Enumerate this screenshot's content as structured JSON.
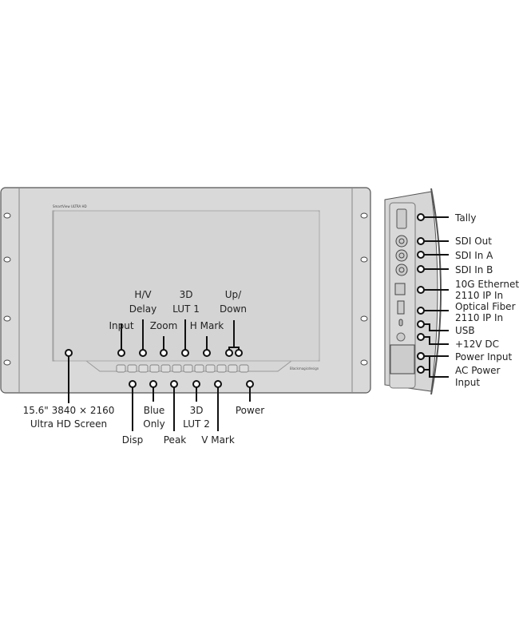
{
  "front_panel": {
    "brand_text": "SmartView ULTRA HD",
    "logo_text": "Blackmagicdesign",
    "labels_top": {
      "input": "Input",
      "hv_delay": [
        "H/V",
        "Delay"
      ],
      "zoom": "Zoom",
      "lut1": [
        "3D",
        "LUT 1"
      ],
      "h_mark": "H Mark",
      "up_down": [
        "Up/",
        "Down"
      ]
    },
    "labels_bottom": {
      "screen": [
        "15.6\" 3840 × 2160",
        "Ultra HD Screen"
      ],
      "disp": "Disp",
      "blue_only": [
        "Blue",
        "Only"
      ],
      "peak": "Peak",
      "lut2": [
        "3D",
        "LUT 2"
      ],
      "v_mark": "V Mark",
      "power": "Power"
    }
  },
  "rear_panel": {
    "labels": {
      "tally": "Tally",
      "sdi_out": "SDI Out",
      "sdi_in_a": "SDI In A",
      "sdi_in_b": "SDI In B",
      "ethernet": [
        "10G Ethernet",
        "2110 IP In"
      ],
      "fiber": [
        "Optical Fiber",
        "2110 IP In"
      ],
      "usb": "USB",
      "dc": "+12V DC",
      "power_input": "Power Input",
      "ac_power": [
        "AC Power",
        "Input"
      ]
    }
  },
  "colors": {
    "chassis": "#d9d9d9",
    "outline": "#555555",
    "callout": "#111111"
  }
}
